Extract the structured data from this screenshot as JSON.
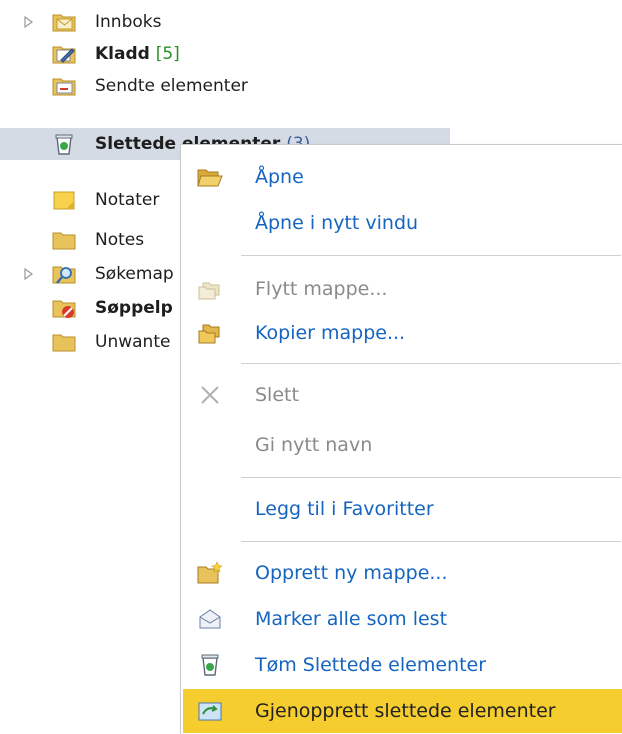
{
  "tree": {
    "items": [
      {
        "label": "Innboks",
        "count": "",
        "bold": false,
        "expandable": true,
        "icon": "inbox-folder-icon"
      },
      {
        "label": "Kladd",
        "count": "[5]",
        "bold": true,
        "expandable": false,
        "icon": "drafts-folder-icon"
      },
      {
        "label": "Sendte elementer",
        "count": "",
        "bold": false,
        "expandable": false,
        "icon": "sent-folder-icon"
      },
      {
        "label": "Slettede elementer",
        "count": "(3)",
        "bold": true,
        "expandable": false,
        "icon": "deleted-items-icon",
        "selected": true
      },
      {
        "label": "Notater",
        "count": "",
        "bold": false,
        "expandable": false,
        "icon": "notes-icon"
      },
      {
        "label": "Notes",
        "count": "",
        "bold": false,
        "expandable": false,
        "icon": "folder-icon"
      },
      {
        "label": "Søkemap",
        "count": "",
        "bold": false,
        "expandable": true,
        "icon": "search-folder-icon"
      },
      {
        "label": "Søppelp",
        "count": "",
        "bold": true,
        "expandable": false,
        "icon": "junk-folder-icon"
      },
      {
        "label": "Unwante",
        "count": "",
        "bold": false,
        "expandable": false,
        "icon": "folder-icon"
      }
    ]
  },
  "menu": {
    "items": [
      {
        "label": "Åpne",
        "enabled": true,
        "icon": "open-folder-icon"
      },
      {
        "label": "Åpne i nytt vindu",
        "enabled": true,
        "icon": ""
      },
      {
        "label": "Flytt mappe...",
        "enabled": false,
        "icon": "move-folder-icon"
      },
      {
        "label": "Kopier mappe...",
        "enabled": true,
        "icon": "copy-folder-icon"
      },
      {
        "label": "Slett",
        "enabled": false,
        "icon": "delete-x-icon"
      },
      {
        "label": "Gi nytt navn",
        "enabled": false,
        "icon": ""
      },
      {
        "label": "Legg til i Favoritter",
        "enabled": true,
        "icon": ""
      },
      {
        "label": "Opprett ny mappe...",
        "enabled": true,
        "icon": "new-folder-icon"
      },
      {
        "label": "Marker alle som lest",
        "enabled": true,
        "icon": "mark-read-icon"
      },
      {
        "label": "Tøm Slettede elementer",
        "enabled": true,
        "icon": "empty-trash-icon"
      },
      {
        "label": "Gjenopprett slettede elementer",
        "enabled": true,
        "icon": "recover-items-icon",
        "highlighted": true
      }
    ]
  },
  "colors": {
    "menu_text": "#1565c0",
    "disabled_text": "#8a8a8a",
    "highlight": "#f5cd2f",
    "selection": "#d4dbe5"
  }
}
